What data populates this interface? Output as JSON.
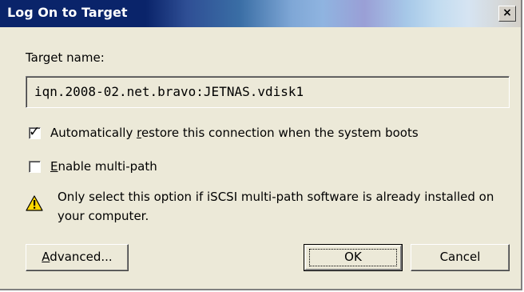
{
  "window": {
    "title": "Log On to Target",
    "close_glyph": "×"
  },
  "target": {
    "label": "Target name:",
    "value": "iqn.2008-02.net.bravo:JETNAS.vdisk1"
  },
  "options": {
    "auto_restore": {
      "label_pre": "Automatically ",
      "label_access": "r",
      "label_post": "estore this connection when the system boots",
      "checked": true
    },
    "multipath": {
      "label_pre": "",
      "label_access": "E",
      "label_post": "nable multi-path",
      "checked": false
    }
  },
  "warning": {
    "icon": "warning-icon",
    "text": "Only select this option if iSCSI multi-path software is already installed on your computer."
  },
  "buttons": {
    "advanced": {
      "access": "A",
      "rest": "dvanced..."
    },
    "ok": "OK",
    "cancel": "Cancel"
  },
  "colors": {
    "title_start": "#0a246a",
    "dialog_face": "#ece9d8",
    "warning_yellow": "#ffd800"
  }
}
